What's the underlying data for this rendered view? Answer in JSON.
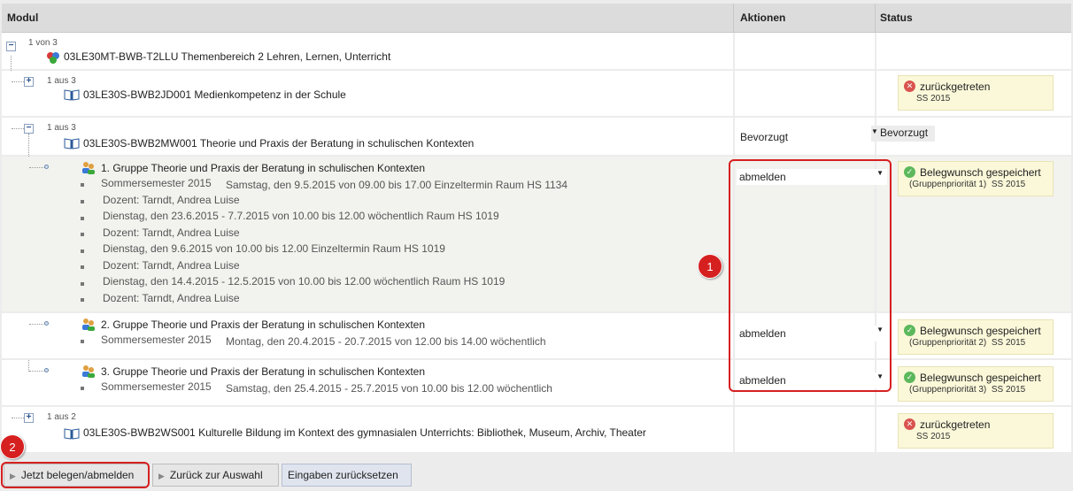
{
  "header": {
    "modul": "Modul",
    "aktionen": "Aktionen",
    "status": "Status"
  },
  "root": {
    "count": "1 von 3",
    "title": "03LE30MT-BWB-T2LLU Themenbereich 2 Lehren, Lernen, Unterricht"
  },
  "module1": {
    "count": "1 aus 3",
    "title": "03LE30S-BWB2JD001 Medienkompetenz in der Schule",
    "status_text": "zurückgetreten",
    "status_sub": "SS 2015"
  },
  "module2": {
    "count": "1 aus 3",
    "title": "03LE30S-BWB2MW001 Theorie und Praxis der Beratung in schulischen Kontexten",
    "action": "Bevorzugt",
    "status_select": "Bevorzugt"
  },
  "group1": {
    "title": "1. Gruppe Theorie und Praxis der Beratung in schulischen Kontexten",
    "semester": "Sommersemester 2015",
    "lines": [
      "Samstag, den 9.5.2015 von 09.00 bis 17.00 Einzeltermin Raum HS 1134",
      "Dozent: Tarndt, Andrea Luise",
      "Dienstag, den 23.6.2015 - 7.7.2015 von 10.00 bis 12.00 wöchentlich Raum HS 1019",
      "Dozent: Tarndt, Andrea Luise",
      "Dienstag, den 9.6.2015 von 10.00 bis 12.00 Einzeltermin Raum HS 1019",
      "Dozent: Tarndt, Andrea Luise",
      "Dienstag, den 14.4.2015 - 12.5.2015 von 10.00 bis 12.00 wöchentlich Raum HS 1019",
      "Dozent: Tarndt, Andrea Luise"
    ],
    "action": "abmelden",
    "status_text": "Belegwunsch gespeichert",
    "status_prio": "(Gruppenpriorität 1)",
    "status_sub": "SS 2015"
  },
  "group2": {
    "title": "2. Gruppe Theorie und Praxis der Beratung in schulischen Kontexten",
    "semester": "Sommersemester 2015",
    "line": "Montag, den 20.4.2015 - 20.7.2015 von 12.00 bis 14.00 wöchentlich",
    "action": "abmelden",
    "status_text": "Belegwunsch gespeichert",
    "status_prio": "(Gruppenpriorität 2)",
    "status_sub": "SS 2015"
  },
  "group3": {
    "title": "3. Gruppe Theorie und Praxis der Beratung in schulischen Kontexten",
    "semester": "Sommersemester 2015",
    "line": "Samstag, den 25.4.2015 - 25.7.2015 von 10.00 bis 12.00 wöchentlich",
    "action": "abmelden",
    "status_text": "Belegwunsch gespeichert",
    "status_prio": "(Gruppenpriorität 3)",
    "status_sub": "SS 2015"
  },
  "module3": {
    "count": "1 aus 2",
    "title": "03LE30S-BWB2WS001 Kulturelle Bildung im Kontext des gymnasialen Unterrichts: Bibliothek, Museum, Archiv, Theater",
    "status_text": "zurückgetreten",
    "status_sub": "SS 2015"
  },
  "annotations": {
    "badge1": "1",
    "badge2": "2"
  },
  "buttons": {
    "submit": "Jetzt belegen/abmelden",
    "back": "Zurück zur Auswahl",
    "reset": "Eingaben zurücksetzen"
  },
  "colors": {
    "annotation": "#d62020",
    "status_bg": "#fbf8d9",
    "ok": "#5cb85c",
    "error": "#d9534f"
  }
}
